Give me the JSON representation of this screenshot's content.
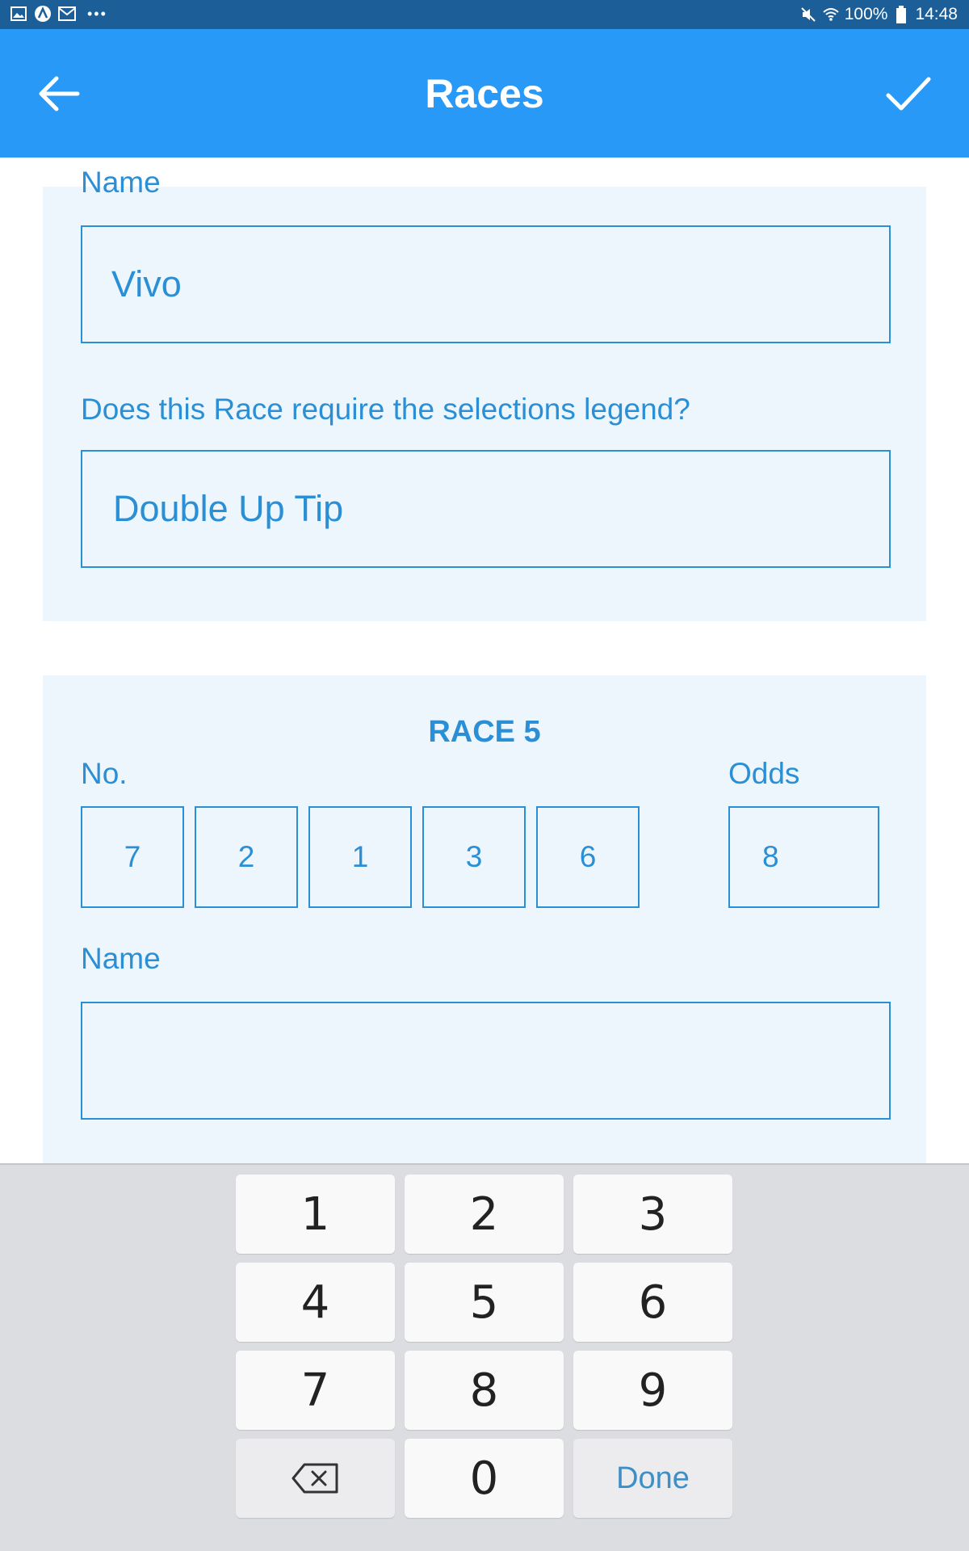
{
  "status_bar": {
    "battery": "100%",
    "time": "14:48",
    "icons": [
      "gallery-icon",
      "app-a-icon",
      "mail-icon",
      "more-dots-icon",
      "mute-icon",
      "wifi-icon",
      "battery-icon"
    ]
  },
  "app_bar": {
    "title": "Races",
    "back_icon": "arrow-left-icon",
    "confirm_icon": "check-icon",
    "color": "#2899f6"
  },
  "section_prev": {
    "name_label": "Name",
    "name_value": "Vivo",
    "legend_question": "Does this Race require the selections legend?",
    "legend_value": "Double Up Tip"
  },
  "race": {
    "title": "RACE 5",
    "no_label": "No.",
    "odds_label": "Odds",
    "numbers": [
      "7",
      "2",
      "1",
      "3",
      "6"
    ],
    "odds": "8",
    "name_label": "Name",
    "name_value": ""
  },
  "keyboard": {
    "keys": [
      "1",
      "2",
      "3",
      "4",
      "5",
      "6",
      "7",
      "8",
      "9",
      "0"
    ],
    "backspace_icon": "backspace-icon",
    "done_label": "Done"
  },
  "colors": {
    "accent": "#2b8fd6",
    "status_bar": "#1c5f98",
    "card_bg": "#eef6fd",
    "keyboard_bg": "#dcdde0"
  }
}
